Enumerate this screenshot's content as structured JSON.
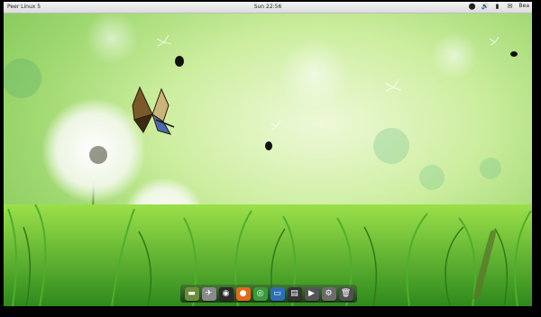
{
  "panel": {
    "app_menu": "Peer Linux 5",
    "clock": "Sun 22:56",
    "user": "Bea"
  },
  "tray_icons": [
    "network-icon",
    "volume-icon",
    "battery-icon",
    "mail-icon",
    "user-icon"
  ],
  "dock_items": [
    {
      "name": "terminal-icon",
      "color": "#6a8f3c",
      "glyph": "▬"
    },
    {
      "name": "rocket-launcher-icon",
      "color": "#8a8a8a",
      "glyph": "✈"
    },
    {
      "name": "steam-icon",
      "color": "#2a2a2a",
      "glyph": "◉"
    },
    {
      "name": "firefox-icon",
      "color": "#e06a1a",
      "glyph": "●"
    },
    {
      "name": "chrome-icon",
      "color": "#3a9a3a",
      "glyph": "◎"
    },
    {
      "name": "screen-icon",
      "color": "#2d6fb5",
      "glyph": "▭"
    },
    {
      "name": "clapperboard-icon",
      "color": "#333333",
      "glyph": "▤"
    },
    {
      "name": "media-player-icon",
      "color": "#555555",
      "glyph": "▶"
    },
    {
      "name": "settings-icon",
      "color": "#6b6b6b",
      "glyph": "⚙"
    },
    {
      "name": "trash-icon",
      "color": "#505050",
      "glyph": "🗑"
    }
  ]
}
